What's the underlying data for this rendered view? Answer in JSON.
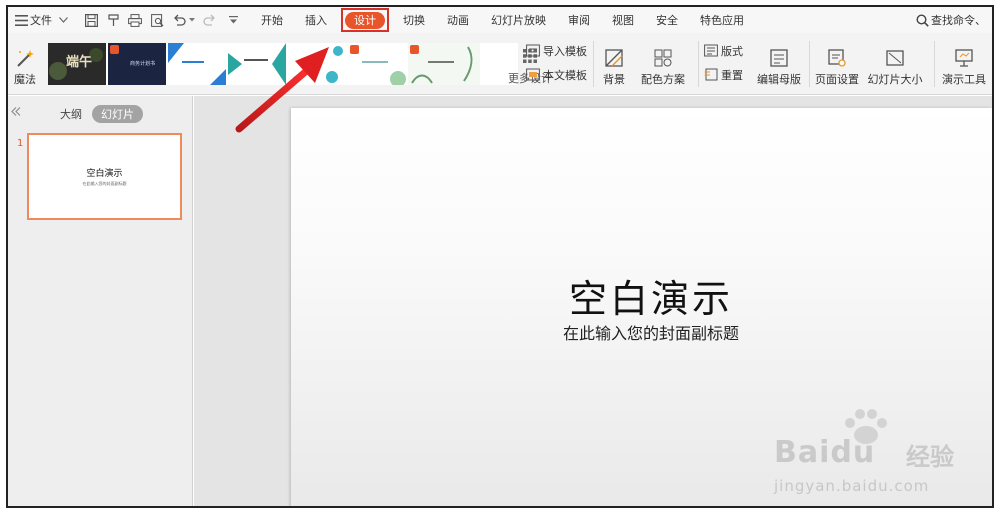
{
  "menubar": {
    "file_label": "文件",
    "tabs": [
      "开始",
      "插入",
      "设计",
      "切换",
      "动画",
      "幻灯片放映",
      "审阅",
      "视图",
      "安全",
      "特色应用"
    ],
    "active_tab": "设计",
    "search_label": "查找命令、"
  },
  "ribbon": {
    "magic_label": "魔法",
    "more_design_label": "更多设计",
    "import_template_label": "导入模板",
    "text_template_label": "本文模板",
    "background_label": "背景",
    "color_scheme_label": "配色方案",
    "layout_label": "版式",
    "reset_label": "重置",
    "edit_master_label": "编辑母版",
    "page_setup_label": "页面设置",
    "slide_size_label": "幻灯片大小",
    "present_tools_label": "演示工具",
    "thumb_1_text": "端午",
    "thumb_2_text": "商务计划书"
  },
  "left_panel": {
    "tab_outline": "大纲",
    "tab_slides": "幻灯片",
    "slide_number": "1",
    "thumb_title": "空白演示",
    "thumb_subtitle": "在此输入您的封面副标题"
  },
  "slide": {
    "title": "空白演示",
    "subtitle": "在此输入您的封面副标题"
  },
  "watermark": {
    "brand": "Baidu",
    "brand_cn": "经验",
    "url": "jingyan.baidu.com"
  },
  "colors": {
    "accent": "#e8552a",
    "highlight_box": "#d9302b",
    "arrow": "#e02020"
  }
}
